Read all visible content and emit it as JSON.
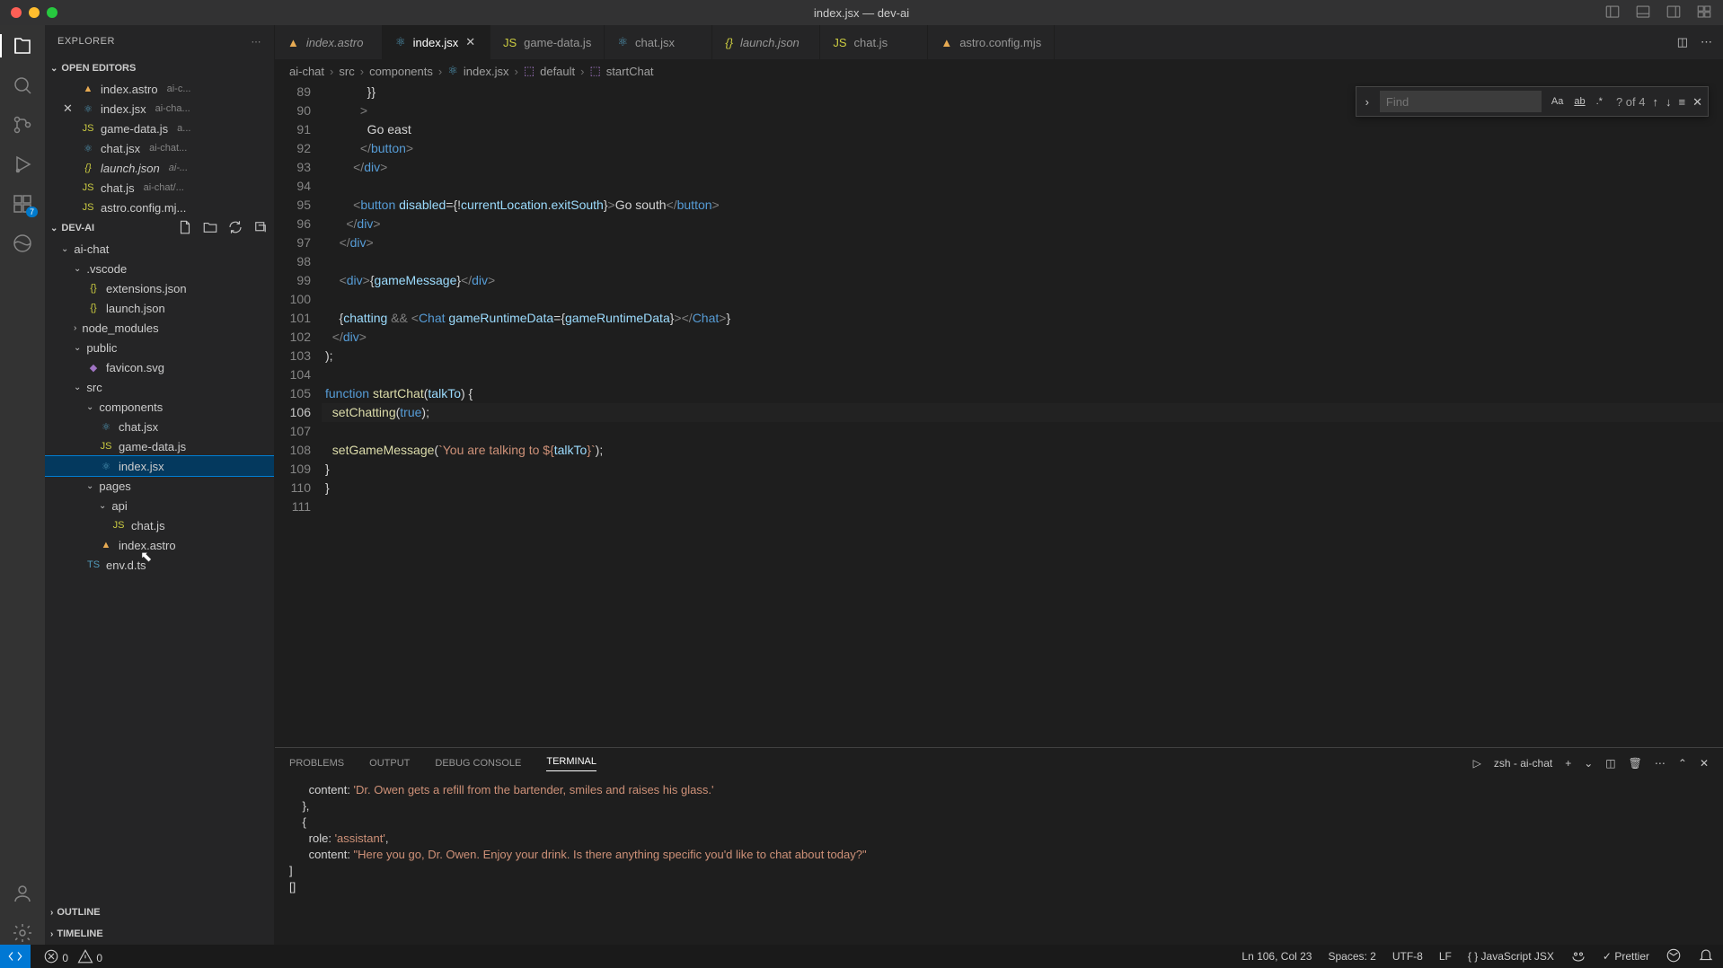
{
  "window": {
    "title": "index.jsx — dev-ai"
  },
  "tabs": [
    {
      "label": "index.astro",
      "icon": "astro",
      "italic": true
    },
    {
      "label": "index.jsx",
      "icon": "react",
      "active": true,
      "close": true
    },
    {
      "label": "game-data.js",
      "icon": "js"
    },
    {
      "label": "chat.jsx",
      "icon": "react"
    },
    {
      "label": "launch.json",
      "icon": "json",
      "italic": true
    },
    {
      "label": "chat.js",
      "icon": "js"
    },
    {
      "label": "astro.config.mjs",
      "icon": "astro"
    }
  ],
  "breadcrumbs": {
    "parts": [
      "ai-chat",
      "src",
      "components",
      "index.jsx",
      "default",
      "startChat"
    ]
  },
  "sidebar": {
    "title": "EXPLORER",
    "openEditors": {
      "label": "OPEN EDITORS"
    },
    "openList": [
      {
        "name": "index.astro",
        "hint": "ai-c...",
        "icon": "astro"
      },
      {
        "name": "index.jsx",
        "hint": "ai-cha...",
        "icon": "react",
        "close": true
      },
      {
        "name": "game-data.js",
        "hint": "a...",
        "icon": "js"
      },
      {
        "name": "chat.jsx",
        "hint": "ai-chat...",
        "icon": "react"
      },
      {
        "name": "launch.json",
        "hint": "ai-...",
        "icon": "json",
        "italic": true
      },
      {
        "name": "chat.js",
        "hint": "ai-chat/...",
        "icon": "js"
      },
      {
        "name": "astro.config.mj...",
        "hint": "",
        "icon": "js"
      }
    ],
    "project": {
      "label": "DEV-AI"
    },
    "tree": [
      {
        "name": "ai-chat",
        "type": "folder",
        "depth": 1,
        "open": true
      },
      {
        "name": ".vscode",
        "type": "folder",
        "depth": 2,
        "open": true
      },
      {
        "name": "extensions.json",
        "type": "file",
        "icon": "json",
        "depth": 3
      },
      {
        "name": "launch.json",
        "type": "file",
        "icon": "json",
        "depth": 3
      },
      {
        "name": "node_modules",
        "type": "folder",
        "depth": 2,
        "open": false
      },
      {
        "name": "public",
        "type": "folder",
        "depth": 2,
        "open": true
      },
      {
        "name": "favicon.svg",
        "type": "file",
        "icon": "svg",
        "depth": 3
      },
      {
        "name": "src",
        "type": "folder",
        "depth": 2,
        "open": true
      },
      {
        "name": "components",
        "type": "folder",
        "depth": 3,
        "open": true
      },
      {
        "name": "chat.jsx",
        "type": "file",
        "icon": "react",
        "depth": 4
      },
      {
        "name": "game-data.js",
        "type": "file",
        "icon": "js",
        "depth": 4
      },
      {
        "name": "index.jsx",
        "type": "file",
        "icon": "react",
        "depth": 4,
        "selected": true
      },
      {
        "name": "pages",
        "type": "folder",
        "depth": 3,
        "open": true
      },
      {
        "name": "api",
        "type": "folder",
        "depth": 4,
        "open": true
      },
      {
        "name": "chat.js",
        "type": "file",
        "icon": "js",
        "depth": 5
      },
      {
        "name": "index.astro",
        "type": "file",
        "icon": "astro",
        "depth": 4
      },
      {
        "name": "env.d.ts",
        "type": "file",
        "icon": "ts",
        "depth": 3
      }
    ],
    "outline": {
      "label": "OUTLINE"
    },
    "timeline": {
      "label": "TIMELINE"
    }
  },
  "find": {
    "placeholder": "Find",
    "count": "? of 4"
  },
  "code": {
    "start": 89,
    "activeLine": 106,
    "lines": [
      "            }}",
      "          >",
      "            Go east",
      "          </button>",
      "        </div>",
      "",
      "        <button disabled={!currentLocation.exitSouth}>Go south</button>",
      "      </div>",
      "    </div>",
      "",
      "    <div>{gameMessage}</div>",
      "",
      "    {chatting && <Chat gameRuntimeData={gameRuntimeData}></Chat>}",
      "  </div>",
      ");",
      "",
      "function startChat(talkTo) {",
      "  setChatting(true);",
      "",
      "  setGameMessage(`You are talking to ${talkTo}`);",
      "}",
      "}",
      ""
    ]
  },
  "panel": {
    "tabs": {
      "problems": "PROBLEMS",
      "output": "OUTPUT",
      "debug": "DEBUG CONSOLE",
      "terminal": "TERMINAL"
    },
    "shell": "zsh - ai-chat",
    "lines": [
      "      content: 'Dr. Owen gets a refill from the bartender, smiles and raises his glass.'",
      "    },",
      "    {",
      "      role: 'assistant',",
      "      content: \"Here you go, Dr. Owen. Enjoy your drink. Is there anything specific you'd like to chat about today?\"",
      "]",
      "[]"
    ]
  },
  "status": {
    "errors": "0",
    "warnings": "0",
    "pos": "Ln 106, Col 23",
    "spaces": "Spaces: 2",
    "encoding": "UTF-8",
    "eol": "LF",
    "lang": "JavaScript JSX",
    "prettier": "Prettier"
  },
  "activity": {
    "badge": "7"
  }
}
